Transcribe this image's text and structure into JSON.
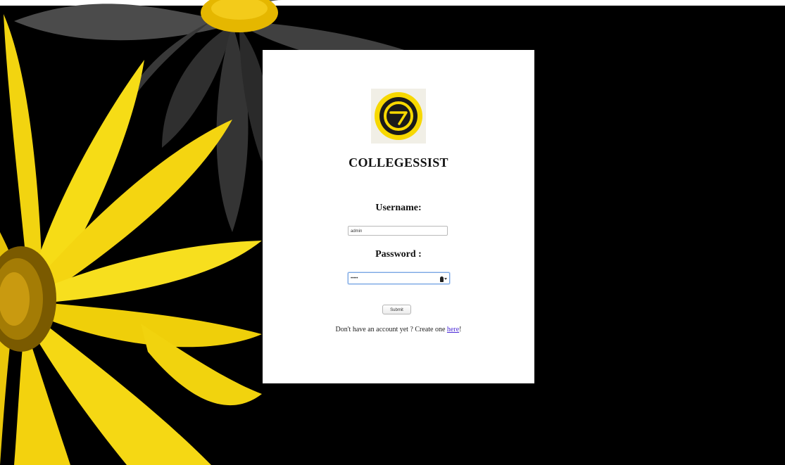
{
  "app": {
    "brand_name": "COLLEGESSIST",
    "logo_icon": "collegessist-logo-icon",
    "brand_colors": {
      "logo_yellow": "#f7d800",
      "logo_dark": "#1a1a1a",
      "link": "#4b2ad6"
    }
  },
  "login_form": {
    "username_label": "Username:",
    "username_value": "admin",
    "password_label": "Password :",
    "password_value": "•••••",
    "password_icons": [
      "key-icon",
      "chevron-down-icon"
    ],
    "submit_label": "Submit",
    "signup_text": "Don't have an account yet ? Create one ",
    "signup_link_label": "here",
    "signup_suffix": "!"
  }
}
